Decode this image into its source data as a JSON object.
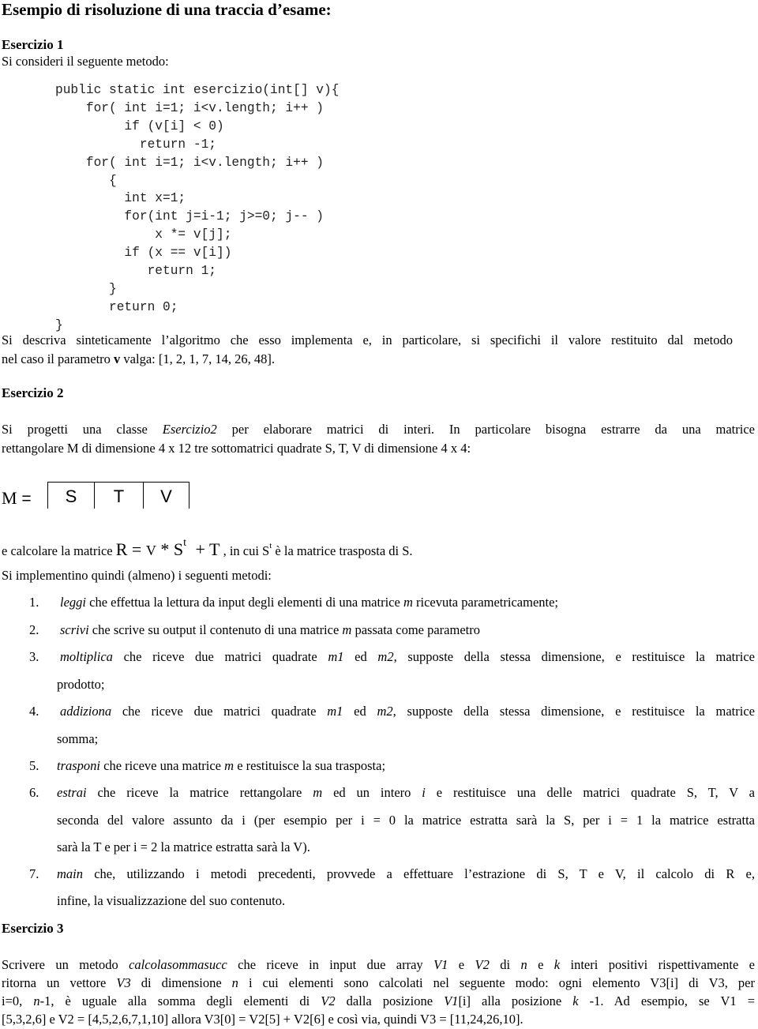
{
  "title": "Esempio di risoluzione di una traccia d’esame:",
  "ex1": {
    "heading": "Esercizio 1",
    "intro": "Si consideri il seguente metodo:",
    "code": [
      "public static int esercizio(int[] v){",
      "    for( int i=1; i<v.length; i++ )",
      "         if (v[i] < 0)",
      "           return -1;",
      "    for( int i=1; i<v.length; i++ )",
      "       {",
      "         int x=1;",
      "         for(int j=i-1; j>=0; j-- )",
      "             x *= v[j];",
      "         if (x == v[i])",
      "            return 1;",
      "       }",
      "       return 0;",
      "}"
    ],
    "question_line1": "Si descriva sinteticamente l’algoritmo che esso implementa e, in particolare, si specifichi il valore restituito dal metodo",
    "question_line2_a": "nel caso il parametro ",
    "question_line2_v": "v",
    "question_line2_b": " valga: [1, 2, 1, 7, 14, 26, 48]."
  },
  "ex2": {
    "heading": "Esercizio 2",
    "p1_a": "Si progetti una classe ",
    "p1_class": "Esercizio2",
    "p1_b": " per elaborare matrici di interi. In particolare bisogna estrarre da una matrice",
    "p1_line2": "rettangolare M di dimensione 4 x 12  tre sottomatrici quadrate S, T, V di dimensione 4 x 4:",
    "matrix_label": "M",
    "matrix_eq": " =",
    "matrix_cells": [
      "S",
      "T",
      "V"
    ],
    "formula_prefix": "e calcolare la matrice ",
    "formula_R": "R",
    "formula_eq": " = ",
    "formula_V": "V",
    "formula_star": " * ",
    "formula_S": "S",
    "formula_t": "t",
    "formula_plus": " + T",
    "formula_suffix_a": " , in cui S",
    "formula_suffix_t": "t",
    "formula_suffix_b": " è la matrice trasposta di S.",
    "methods_intro": "Si implementino quindi (almeno) i seguenti metodi:",
    "methods": [
      {
        "num": "1.",
        "name": "leggi",
        "text": " che effettua la lettura da input degli elementi di una matrice ",
        "var": "m",
        "text2": " ricevuta parametricamente;"
      },
      {
        "num": "2.",
        "name": "scrivi",
        "text": " che scrive su output il contenuto di una matrice ",
        "var": "m",
        "text2": " passata come parametro"
      },
      {
        "num": "3.",
        "name": "moltiplica",
        "text": " che riceve due matrici quadrate ",
        "var": "m1",
        "mid": " ed ",
        "var2": "m2",
        "text2": ", supposte della stessa dimensione, e restituisce la matrice",
        "cont": "prodotto;"
      },
      {
        "num": "4.",
        "name": "addiziona",
        "text": " che riceve due matrici quadrate ",
        "var": "m1",
        "mid": " ed ",
        "var2": "m2",
        "text2": ", supposte della stessa dimensione, e restituisce la matrice",
        "cont": "somma;"
      },
      {
        "num": "5.",
        "name": "trasponi",
        "text": " che riceve una matrice ",
        "var": "m",
        "text2": " e restituisce la sua trasposta;"
      },
      {
        "num": "6.",
        "name": "estrai",
        "text": " che riceve la matrice rettangolare ",
        "var": "m",
        "mid": " ed un intero ",
        "var2": "i",
        "text2": " e restituisce una delle matrici quadrate S, T, V a",
        "cont": "seconda del valore assunto da i  (per esempio per i = 0 la matrice estratta sarà la S, per  i = 1 la matrice estratta",
        "cont2": "sarà la T e per i = 2 la matrice estratta sarà la V)."
      },
      {
        "num": "7.",
        "name": "main",
        "text": " che, utilizzando i metodi precedenti, provvede a effettuare l’estrazione di S, T e V, il calcolo di R e,",
        "cont": "infine, la visualizzazione del suo contenuto."
      }
    ]
  },
  "ex3": {
    "heading": "Esercizio 3",
    "l1_a": "Scrivere un metodo ",
    "l1_method": "calcolasommasucc",
    "l1_b": "  che riceve in input due array ",
    "l1_v1": "V1",
    "l1_c": " e ",
    "l1_v2": "V2",
    "l1_d": " di  ",
    "l1_n": "n",
    "l1_e": " e ",
    "l1_k": "k",
    "l1_f": " interi positivi rispettivamente e",
    "l2_a": "ritorna un vettore ",
    "l2_v3": "V3",
    "l2_b": " di dimensione ",
    "l2_n": "n",
    "l2_c": " i cui elementi sono calcolati nel seguente modo:  ogni elemento V3[i]  di V3, per",
    "l3_a": "i=0, ",
    "l3_n": "n",
    "l3_b": "-1,   è uguale alla somma degli elementi di  ",
    "l3_v2": "V2",
    "l3_c": " dalla posizione ",
    "l3_v1": "V1",
    "l3_d": "[i]  alla posizione  ",
    "l3_k": "k",
    "l3_e": " -1. Ad esempio, se V1 =",
    "l4": "[5,3,2,6] e V2 = [4,5,2,6,7,1,10] allora V3[0] = V2[5] + V2[6] e così via, quindi V3 = [11,24,26,10]."
  }
}
